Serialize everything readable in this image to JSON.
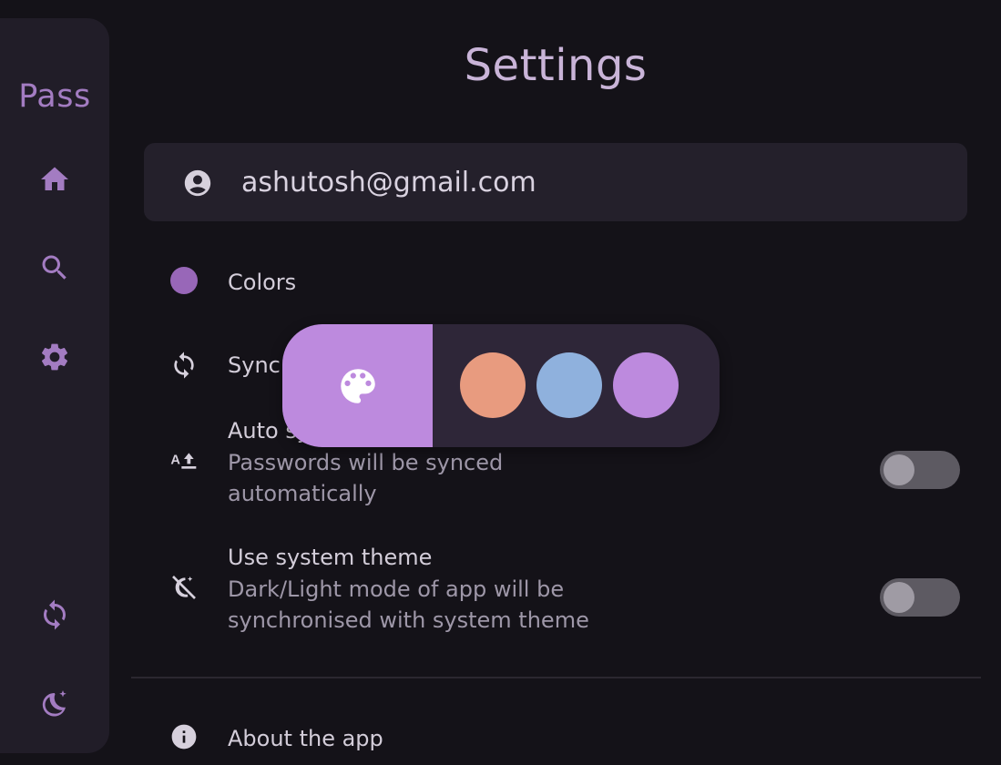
{
  "app": {
    "title": "Pass",
    "accent": "#a37cc2"
  },
  "rail": {
    "items": [
      {
        "name": "home",
        "icon": "home-icon"
      },
      {
        "name": "search",
        "icon": "search-icon"
      },
      {
        "name": "settings",
        "icon": "gear-icon"
      },
      {
        "name": "sync",
        "icon": "sync-icon"
      },
      {
        "name": "theme",
        "icon": "moon-icon"
      }
    ]
  },
  "page": {
    "title": "Settings"
  },
  "account": {
    "email": "ashutosh@gmail.com",
    "icon": "account-circle-icon"
  },
  "settings": {
    "colors_label": "Colors",
    "colors_dot_color": "#9867b8",
    "sync_label": "Sync",
    "auto_sync": {
      "label": "Auto sync",
      "description_line1": "Passwords will be synced",
      "description_line2": "automatically",
      "enabled": false
    },
    "system_theme": {
      "label": "Use system theme",
      "description_line1": "Dark/Light mode of app will be",
      "description_line2": "synchronised with system theme",
      "enabled": false
    },
    "about_label": "About the app"
  },
  "color_picker": {
    "palette_icon": "palette-icon",
    "palette_color": "#bd8ade",
    "swatches": [
      "#e89b7f",
      "#8fb1dd",
      "#bd8ade"
    ]
  }
}
